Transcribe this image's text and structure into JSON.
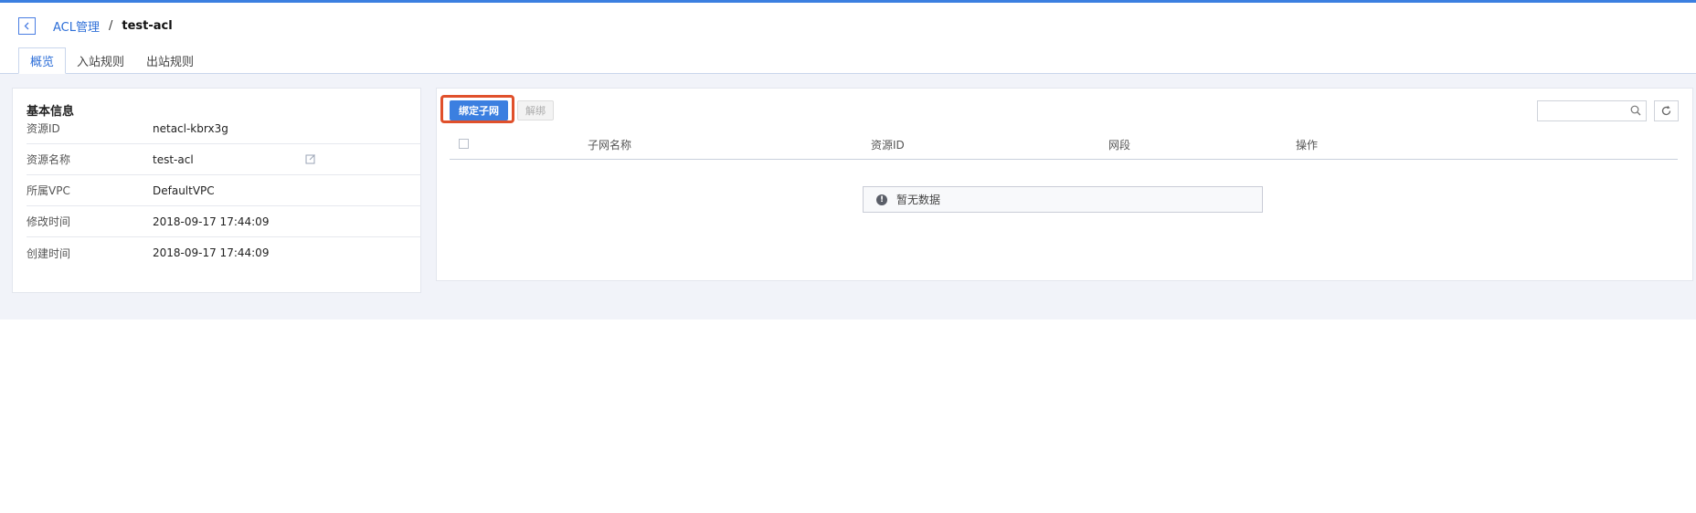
{
  "breadcrumb": {
    "parent": "ACL管理",
    "separator": "/",
    "current": "test-acl"
  },
  "tabs": [
    {
      "label": "概览",
      "active": true
    },
    {
      "label": "入站规则",
      "active": false
    },
    {
      "label": "出站规则",
      "active": false
    }
  ],
  "basic_info": {
    "title": "基本信息",
    "rows": [
      {
        "label": "资源ID",
        "value": "netacl-kbrx3g"
      },
      {
        "label": "资源名称",
        "value": "test-acl"
      },
      {
        "label": "所属VPC",
        "value": "DefaultVPC"
      },
      {
        "label": "修改时间",
        "value": "2018-09-17 17:44:09"
      },
      {
        "label": "创建时间",
        "value": "2018-09-17 17:44:09"
      }
    ]
  },
  "toolbar": {
    "bind_label": "绑定子网",
    "unbind_label": "解绑",
    "search_placeholder": ""
  },
  "table": {
    "columns": [
      "子网名称",
      "资源ID",
      "网段",
      "操作"
    ],
    "empty_text": "暂无数据"
  },
  "colors": {
    "accent": "#3b7fe0",
    "highlight": "#e0502b"
  }
}
